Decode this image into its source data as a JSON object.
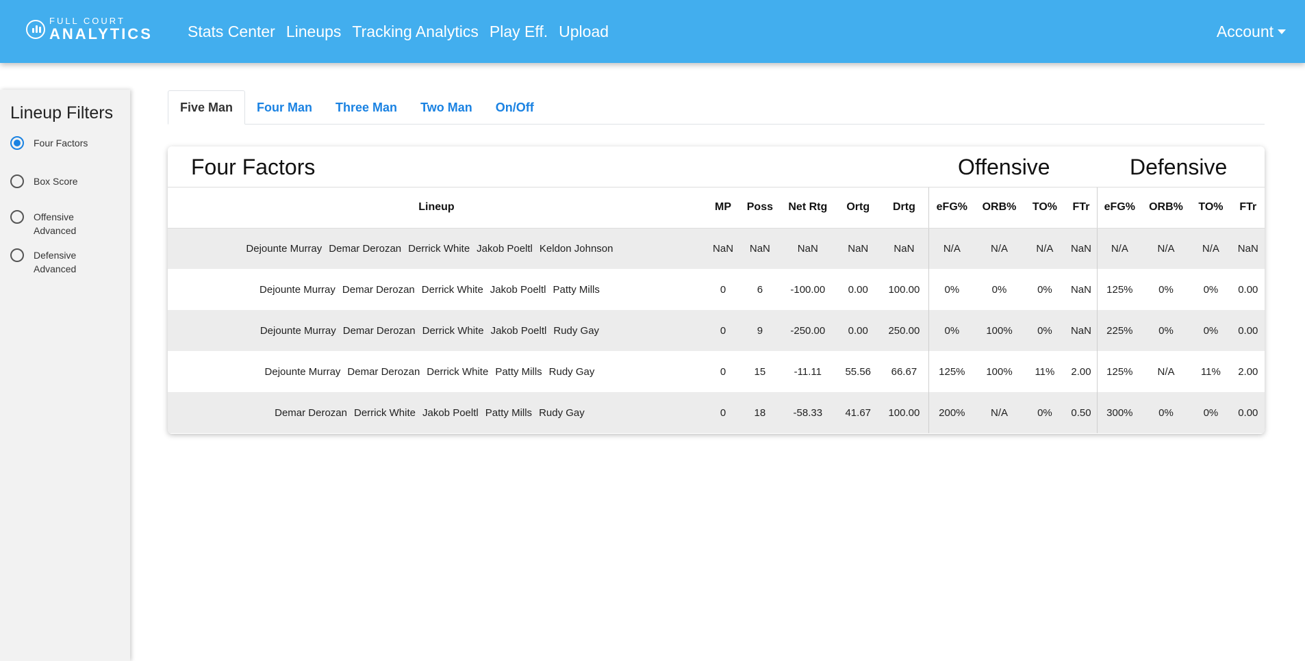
{
  "brand": {
    "top": "FULL COURT",
    "bottom": "ANALYTICS"
  },
  "nav": [
    "Stats Center",
    "Lineups",
    "Tracking Analytics",
    "Play Eff.",
    "Upload"
  ],
  "account": "Account",
  "sidebar": {
    "title": "Lineup Filters",
    "options": [
      {
        "label": "Four Factors",
        "checked": true
      },
      {
        "label": "Box Score",
        "checked": false
      },
      {
        "label": "Offensive Advanced",
        "checked": false
      },
      {
        "label": "Defensive Advanced",
        "checked": false
      }
    ]
  },
  "tabs": [
    {
      "label": "Five Man",
      "active": true
    },
    {
      "label": "Four Man",
      "active": false
    },
    {
      "label": "Three Man",
      "active": false
    },
    {
      "label": "Two Man",
      "active": false
    },
    {
      "label": "On/Off",
      "active": false
    }
  ],
  "card": {
    "title": "Four Factors",
    "offensive": "Offensive",
    "defensive": "Defensive"
  },
  "table": {
    "columns": [
      "Lineup",
      "MP",
      "Poss",
      "Net Rtg",
      "Ortg",
      "Drtg",
      "eFG%",
      "ORB%",
      "TO%",
      "FTr",
      "eFG%",
      "ORB%",
      "TO%",
      "FTr"
    ],
    "rows": [
      {
        "lineup": [
          "Dejounte Murray",
          "Demar Derozan",
          "Derrick White",
          "Jakob Poeltl",
          "Keldon Johnson"
        ],
        "stats": [
          "NaN",
          "NaN",
          "NaN",
          "NaN",
          "NaN",
          "N/A",
          "N/A",
          "N/A",
          "NaN",
          "N/A",
          "N/A",
          "N/A",
          "NaN"
        ]
      },
      {
        "lineup": [
          "Dejounte Murray",
          "Demar Derozan",
          "Derrick White",
          "Jakob Poeltl",
          "Patty Mills"
        ],
        "stats": [
          "0",
          "6",
          "-100.00",
          "0.00",
          "100.00",
          "0%",
          "0%",
          "0%",
          "NaN",
          "125%",
          "0%",
          "0%",
          "0.00"
        ]
      },
      {
        "lineup": [
          "Dejounte Murray",
          "Demar Derozan",
          "Derrick White",
          "Jakob Poeltl",
          "Rudy Gay"
        ],
        "stats": [
          "0",
          "9",
          "-250.00",
          "0.00",
          "250.00",
          "0%",
          "100%",
          "0%",
          "NaN",
          "225%",
          "0%",
          "0%",
          "0.00"
        ]
      },
      {
        "lineup": [
          "Dejounte Murray",
          "Demar Derozan",
          "Derrick White",
          "Patty Mills",
          "Rudy Gay"
        ],
        "stats": [
          "0",
          "15",
          "-11.11",
          "55.56",
          "66.67",
          "125%",
          "100%",
          "11%",
          "2.00",
          "125%",
          "N/A",
          "11%",
          "2.00"
        ]
      },
      {
        "lineup": [
          "Demar Derozan",
          "Derrick White",
          "Jakob Poeltl",
          "Patty Mills",
          "Rudy Gay"
        ],
        "stats": [
          "0",
          "18",
          "-58.33",
          "41.67",
          "100.00",
          "200%",
          "N/A",
          "0%",
          "0.50",
          "300%",
          "0%",
          "0%",
          "0.00"
        ]
      }
    ]
  },
  "colors": {
    "navbar": "#42aeee",
    "link": "#1a82e2",
    "stripe": "#ececec"
  }
}
